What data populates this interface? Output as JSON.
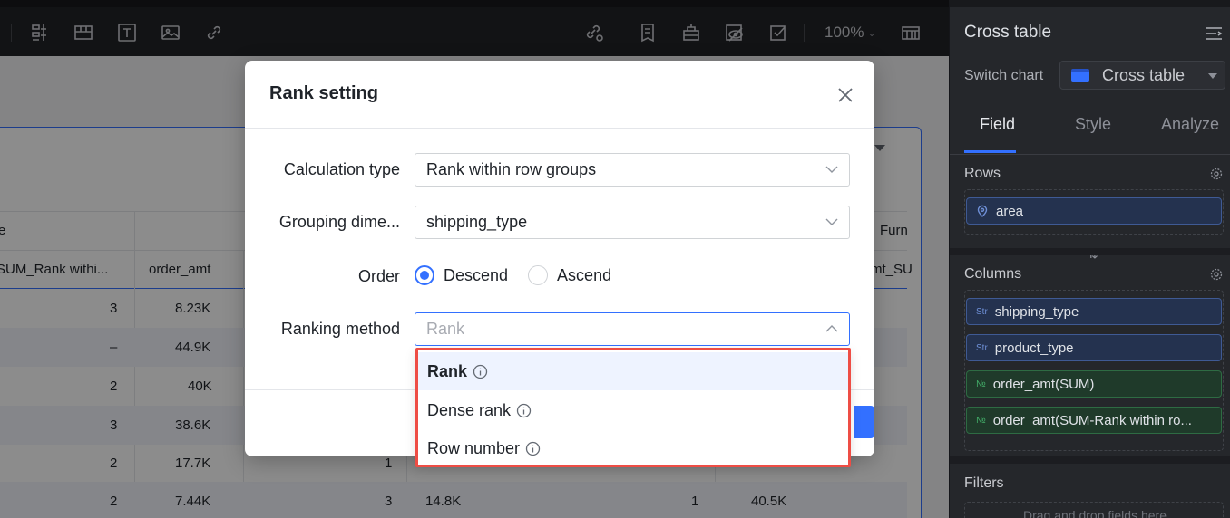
{
  "toolbar": {
    "zoom": "100%",
    "left_icons": [
      "filter-icon",
      "layout-icon",
      "text-icon",
      "image-icon",
      "link-icon"
    ],
    "right_icons": [
      "linkage-icon",
      "report-icon",
      "bundle-icon",
      "hide-icon",
      "check-icon",
      "table-icon"
    ]
  },
  "table": {
    "header_top": [
      "e",
      "Furn"
    ],
    "header_cols": [
      "SUM_Rank withi...",
      "order_amt",
      "mt_SU"
    ],
    "rows": [
      {
        "rank": "3",
        "amt": "8.23K"
      },
      {
        "rank": "–",
        "amt": "44.9K"
      },
      {
        "rank": "2",
        "amt": "40K"
      },
      {
        "rank": "3",
        "amt": "38.6K"
      },
      {
        "rank": "2",
        "amt": "17.7K",
        "c3": "1"
      },
      {
        "rank": "2",
        "amt": "7.44K",
        "c3": "3",
        "c4": "14.8K",
        "c5": "1",
        "c6": "40.5K"
      }
    ]
  },
  "panel": {
    "title": "Cross table",
    "switch_label": "Switch chart",
    "switch_value": "Cross table",
    "tabs": [
      "Field",
      "Style",
      "Analyze"
    ],
    "active_tab": "Field",
    "rows_label": "Rows",
    "rows": [
      {
        "name": "area",
        "icon": "location-icon"
      }
    ],
    "columns_label": "Columns",
    "columns": [
      {
        "tag": "Str",
        "name": "shipping_type",
        "kind": "dim"
      },
      {
        "tag": "Str",
        "name": "product_type",
        "kind": "dim"
      },
      {
        "tag": "№",
        "name": "order_amt(SUM)",
        "kind": "mea"
      },
      {
        "tag": "№",
        "name": "order_amt(SUM-Rank within ro...",
        "kind": "mea"
      }
    ],
    "filters_label": "Filters",
    "filters_placeholder": "Drag and drop fields here"
  },
  "modal": {
    "title": "Rank setting",
    "calc_type_label": "Calculation type",
    "calc_type_value": "Rank within row groups",
    "grouping_label": "Grouping dime...",
    "grouping_value": "shipping_type",
    "order_label": "Order",
    "order_options": [
      "Descend",
      "Ascend"
    ],
    "order_selected": "Descend",
    "ranking_label": "Ranking method",
    "ranking_placeholder": "Rank"
  },
  "dropdown": {
    "options": [
      "Rank",
      "Dense rank",
      "Row number"
    ],
    "selected": "Rank"
  },
  "colors": {
    "accent": "#3370ff",
    "highlight_border": "#ee4d45",
    "panel_bg": "#25272b",
    "toolbar_bg": "#222327"
  }
}
